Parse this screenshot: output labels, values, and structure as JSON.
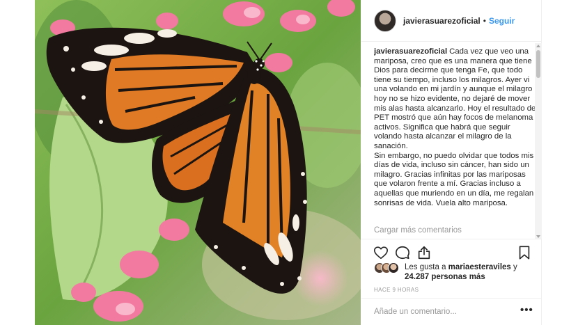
{
  "post": {
    "username": "javierasuarezoficial",
    "follow_label": "Seguir",
    "separator": "•",
    "caption_user": "javierasuarezoficial",
    "caption_text": "Cada vez que veo una mariposa, creo que es una manera que tiene Dios para decirme que tenga Fe, que todo tiene su tiempo, incluso los milagros. Ayer vi una volando en mi jardín y aunque el milagro hoy no se hizo evidente, no dejaré de mover mis alas hasta alcanzarlo. Hoy el resultado del PET mostró que aún hay focos de melanoma activos. Significa que habrá que seguir volando hasta alcanzar el milagro de la sanación.\nSin embargo, no puedo olvidar que todos mis días de vida, incluso sin cáncer, han sido un milagro. Gracias infinitas por las mariposas que volaron frente a mí. Gracias incluso a aquellas que muriendo en un día, me regalan sonrisas de vida. Vuela alto mariposa.",
    "load_more_comments": "Cargar más comentarios",
    "likes_prefix": "Les gusta a ",
    "likes_user": "mariaesteraviles",
    "likes_suffix": " y",
    "likes_count_text": "24.287 personas más",
    "time_ago": "HACE 9 HORAS",
    "add_comment_placeholder": "Añade un comentario...",
    "more_options": "•••"
  },
  "icons": {
    "like": "heart-icon",
    "comment": "comment-bubble-icon",
    "share": "share-icon",
    "save": "bookmark-icon"
  },
  "colors": {
    "link_blue": "#3897f0",
    "text": "#262626",
    "muted": "#999999",
    "border": "#efefef"
  }
}
